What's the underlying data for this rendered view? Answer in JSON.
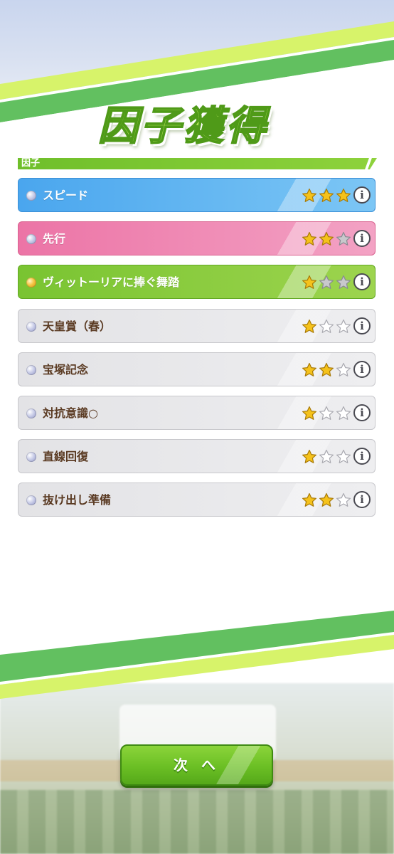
{
  "screen": {
    "title": "因子獲得",
    "section_label": "因子",
    "next_button_label": "次 へ"
  },
  "colors": {
    "blue": "#4aa6ee",
    "pink": "#ec74a6",
    "green": "#79c431",
    "gray": "#e3e3e6",
    "star_gold": "#f5c21b",
    "star_empty": "#c8c8cc"
  },
  "factors": [
    {
      "name": "スピード",
      "type": "blue",
      "gem": "silver",
      "stars_filled": 3,
      "stars_total": 3
    },
    {
      "name": "先行",
      "type": "pink",
      "gem": "silver",
      "stars_filled": 2,
      "stars_total": 3
    },
    {
      "name": "ヴィットーリアに捧ぐ舞踏",
      "type": "green",
      "gem": "gold",
      "stars_filled": 1,
      "stars_total": 3
    },
    {
      "name": "天皇賞（春）",
      "type": "gray",
      "gem": "silver",
      "stars_filled": 1,
      "stars_total": 3
    },
    {
      "name": "宝塚記念",
      "type": "gray",
      "gem": "silver",
      "stars_filled": 2,
      "stars_total": 3
    },
    {
      "name": "対抗意識○",
      "type": "gray",
      "gem": "silver",
      "stars_filled": 1,
      "stars_total": 3
    },
    {
      "name": "直線回復",
      "type": "gray",
      "gem": "silver",
      "stars_filled": 1,
      "stars_total": 3
    },
    {
      "name": "抜け出し準備",
      "type": "gray",
      "gem": "silver",
      "stars_filled": 2,
      "stars_total": 3
    }
  ],
  "info_icon": "info-icon",
  "info_glyph": "i"
}
